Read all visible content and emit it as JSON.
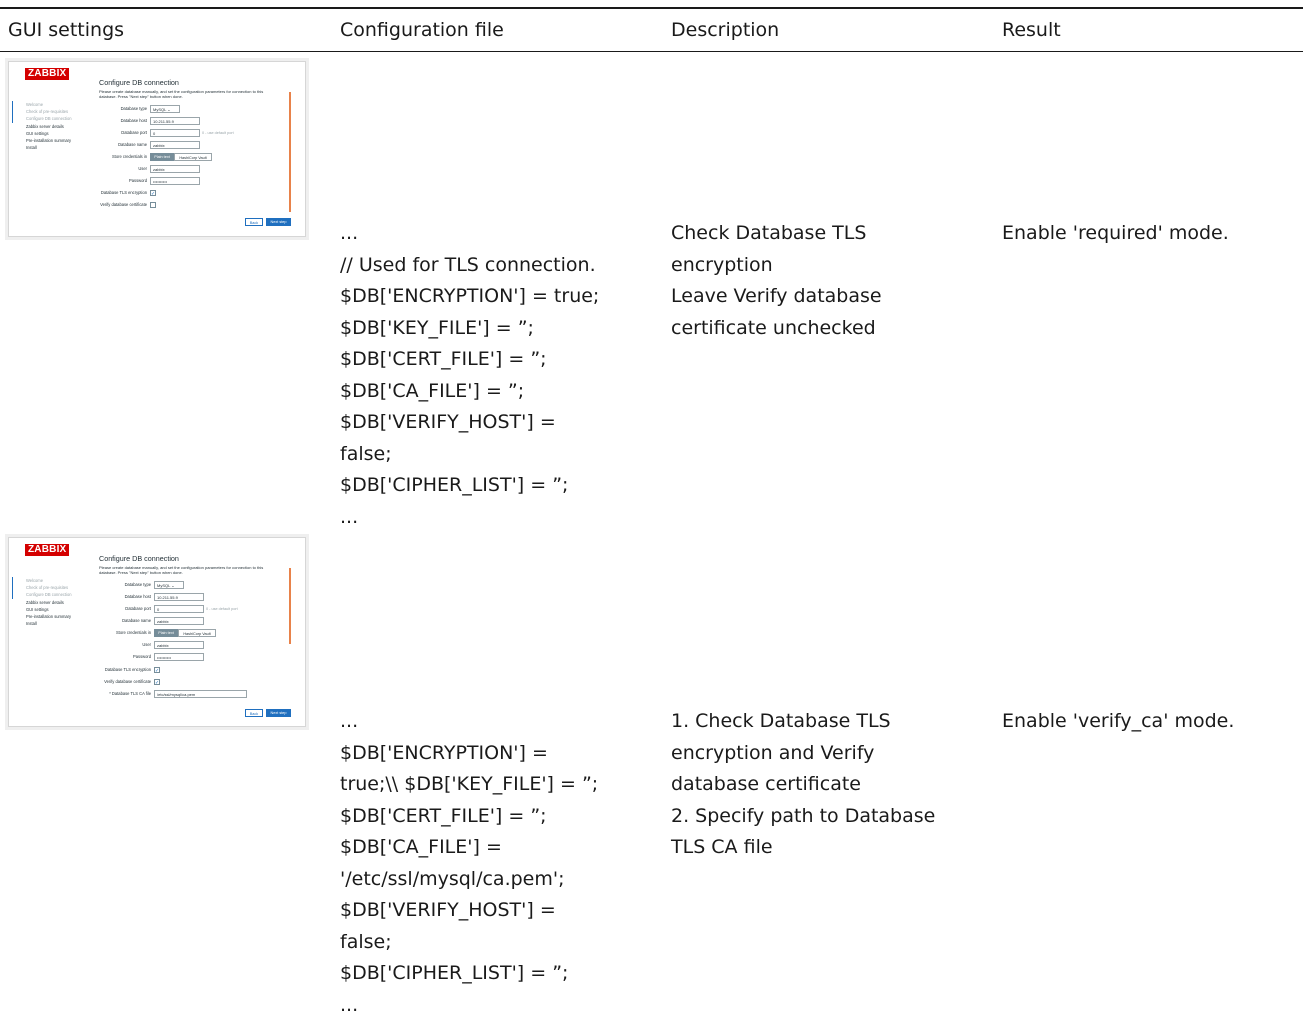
{
  "table": {
    "headers": [
      "GUI settings",
      "Configuration file",
      "Description",
      "Result"
    ],
    "rows": [
      {
        "config_lines": [
          "...",
          "// Used for TLS connection.",
          "$DB['ENCRYPTION'] = true;",
          "$DB['KEY_FILE'] = ”;",
          "$DB['CERT_FILE'] = ”;",
          "$DB['CA_FILE'] = ”;",
          "$DB['VERIFY_HOST'] =",
          "false;",
          "$DB['CIPHER_LIST'] = ”;",
          "..."
        ],
        "description_lines": [
          "Check Database TLS",
          "encryption",
          "Leave Verify database",
          "certificate unchecked"
        ],
        "result": "Enable 'required' mode."
      },
      {
        "config_lines": [
          "...",
          "$DB['ENCRYPTION'] =",
          "true;\\\\ $DB['KEY_FILE'] = ”;",
          "$DB['CERT_FILE'] = ”;",
          "$DB['CA_FILE'] =",
          "'/etc/ssl/mysql/ca.pem';",
          "$DB['VERIFY_HOST'] =",
          "false;",
          "$DB['CIPHER_LIST'] = ”;",
          "..."
        ],
        "description_lines": [
          "1. Check Database TLS",
          "encryption and Verify",
          "database certificate",
          "2. Specify path to Database",
          "TLS CA file"
        ],
        "result": "Enable 'verify_ca' mode."
      }
    ]
  },
  "thumbnails": [
    {
      "logo": "ZABBIX",
      "title": "Configure DB connection",
      "intro": "Please create database manually, and set the configuration parameters for connection to this database. Press \"Next step\" button when done.",
      "steps": [
        "Welcome",
        "Check of pre-requisites",
        "Configure DB connection",
        "Zabbix server details",
        "GUI settings",
        "Pre-installation summary",
        "Install"
      ],
      "fields": {
        "db_type_label": "Database type",
        "db_type_value": "MySQL",
        "db_host_label": "Database host",
        "db_host_value": "10.211.55.9",
        "db_port_label": "Database port",
        "db_port_value": "0",
        "db_port_hint": "0 - use default port",
        "db_name_label": "Database name",
        "db_name_value": "zabbix",
        "store_label": "Store credentials in",
        "store_plain": "Plain text",
        "store_vault": "HashiCorp Vault",
        "user_label": "User",
        "user_value": "zabbix",
        "password_label": "Password",
        "password_value": "••••••••••",
        "tls_label": "Database TLS encryption",
        "verify_label": "Verify database certificate"
      },
      "tls_checked": true,
      "verify_checked": false,
      "back_label": "Back",
      "next_label": "Next step"
    },
    {
      "logo": "ZABBIX",
      "title": "Configure DB connection",
      "intro": "Please create database manually, and set the configuration parameters for connection to this database. Press \"Next step\" button when done.",
      "steps": [
        "Welcome",
        "Check of pre-requisites",
        "Configure DB connection",
        "Zabbix server details",
        "GUI settings",
        "Pre-installation summary",
        "Install"
      ],
      "fields": {
        "db_type_label": "Database type",
        "db_type_value": "MySQL",
        "db_host_label": "Database host",
        "db_host_value": "10.211.55.9",
        "db_port_label": "Database port",
        "db_port_value": "0",
        "db_port_hint": "0 - use default port",
        "db_name_label": "Database name",
        "db_name_value": "zabbix",
        "store_label": "Store credentials in",
        "store_plain": "Plain text",
        "store_vault": "HashiCorp Vault",
        "user_label": "User",
        "user_value": "zabbix",
        "password_label": "Password",
        "password_value": "••••••••••",
        "tls_label": "Database TLS encryption",
        "verify_label": "Verify database certificate",
        "ca_label": "* Database TLS CA file",
        "ca_value": "/etc/ssl/mysql/ca.pem"
      },
      "tls_checked": true,
      "verify_checked": true,
      "check_glyph": "✓",
      "back_label": "Back",
      "next_label": "Next step"
    }
  ]
}
